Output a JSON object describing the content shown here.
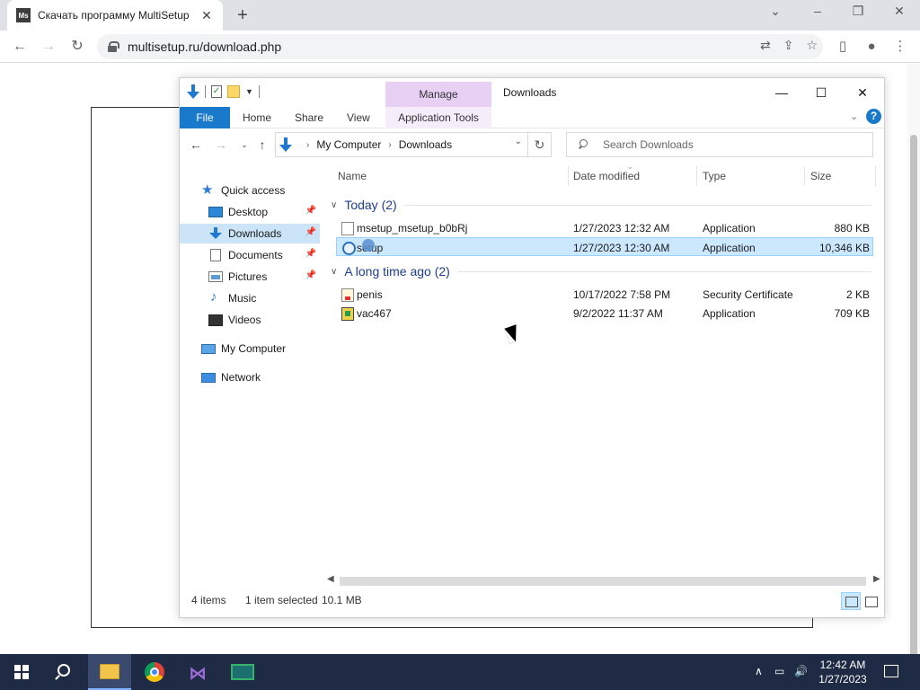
{
  "browser": {
    "tab_title": "Скачать программу MultiSetup",
    "tab_favicon": "Ms",
    "url": "multisetup.ru/download.php"
  },
  "explorer": {
    "title": "Downloads",
    "manage_label": "Manage",
    "ribbon": {
      "file": "File",
      "home": "Home",
      "share": "Share",
      "view": "View",
      "app_tools": "Application Tools"
    },
    "address": {
      "crumbs": [
        "My Computer",
        "Downloads"
      ]
    },
    "search_placeholder": "Search Downloads",
    "nav": {
      "quick_access": "Quick access",
      "desktop": "Desktop",
      "downloads": "Downloads",
      "documents": "Documents",
      "pictures": "Pictures",
      "music": "Music",
      "videos": "Videos",
      "my_computer": "My Computer",
      "network": "Network"
    },
    "columns": {
      "name": "Name",
      "date": "Date modified",
      "type": "Type",
      "size": "Size"
    },
    "groups": [
      {
        "label": "Today (2)",
        "files": [
          {
            "name": "msetup_msetup_b0bRj",
            "date": "1/27/2023 12:32 AM",
            "type": "Application",
            "size": "880 KB",
            "icon": "app-icon"
          },
          {
            "name": "setup",
            "date": "1/27/2023 12:30 AM",
            "type": "Application",
            "size": "10,346 KB",
            "icon": "setup-icon"
          }
        ]
      },
      {
        "label": "A long time ago (2)",
        "files": [
          {
            "name": "penis",
            "date": "10/17/2022 7:58 PM",
            "type": "Security Certificate",
            "size": "2 KB",
            "icon": "certificate-icon"
          },
          {
            "name": "vac467",
            "date": "9/2/2022 11:37 AM",
            "type": "Application",
            "size": "709 KB",
            "icon": "vac-app-icon"
          }
        ]
      }
    ],
    "status": {
      "items": "4 items",
      "selected": "1 item selected",
      "size": "10.1 MB"
    }
  },
  "taskbar": {
    "time": "12:42 AM",
    "date": "1/27/2023"
  },
  "colors": {
    "accent": "#1979ca",
    "selection": "#cce8ff",
    "manage_tab": "#e8d0f5",
    "taskbar": "#1f2a44"
  }
}
